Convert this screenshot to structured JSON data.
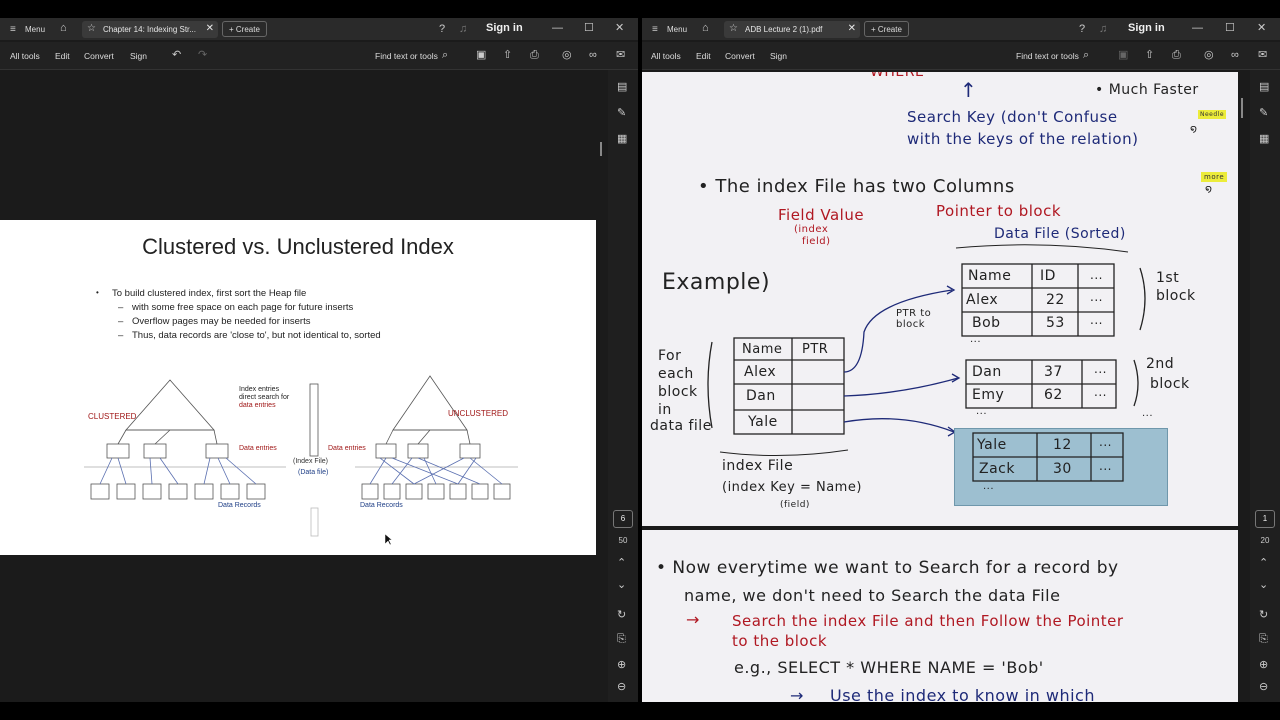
{
  "left": {
    "menu_label": "Menu",
    "tab_title": "Chapter 14: Indexing Str...",
    "create_label": "Create",
    "sign_in": "Sign in",
    "toolbar": {
      "all_tools": "All tools",
      "edit": "Edit",
      "convert": "Convert",
      "sign": "Sign",
      "find": "Find text or tools"
    },
    "page_number": "6",
    "page_total": "50",
    "slide": {
      "title": "Clustered vs. Unclustered Index",
      "bullet": "To build clustered index, first sort the Heap file",
      "sub_bullets": [
        "with some free space on each page for future inserts",
        "Overflow pages may be needed for inserts",
        "Thus, data records are 'close to', but not identical to, sorted"
      ],
      "diagram": {
        "clustered": "CLUSTERED",
        "unclustered": "UNCLUSTERED",
        "index_entries_line1": "Index entries",
        "index_entries_line2": "direct search for",
        "index_entries_line3": "data entries",
        "data_entries_left": "Data entries",
        "data_entries_right": "Data entries",
        "index_file": "(Index File)",
        "data_file": "(Data file)",
        "data_records_left": "Data Records",
        "data_records_right": "Data Records"
      }
    }
  },
  "right": {
    "menu_label": "Menu",
    "tab_title": "ADB Lecture 2 (1).pdf",
    "create_label": "Create",
    "sign_in": "Sign in",
    "toolbar": {
      "all_tools": "All tools",
      "edit": "Edit",
      "convert": "Convert",
      "sign": "Sign",
      "find": "Find text or tools"
    },
    "page_number": "1",
    "page_total": "20",
    "notes_page1": {
      "where_partial": "WHERE",
      "search_key_line1": "Search Key (don't Confuse",
      "search_key_line2": "with the keys of the relation)",
      "much_faster": "• Much Faster",
      "index_file_cols": "• The index File has two Columns",
      "field_value": "Field Value",
      "index_field_line1": "(index",
      "index_field_line2": "field)",
      "pointer_to_block": "Pointer to block",
      "data_file_sorted": "Data File (Sorted)",
      "example": "Example)",
      "ptr_to_block_line1": "PTR to",
      "ptr_to_block_line2": "block",
      "for_each_line1": "For",
      "for_each_line2": "each",
      "for_each_line3": "block",
      "for_each_line4": "in",
      "for_each_line5": "data file",
      "index_table_headers": [
        "Name",
        "PTR"
      ],
      "index_table_rows": [
        "Alex",
        "Dan",
        "Yale"
      ],
      "block1_header": [
        "Name",
        "ID",
        "..."
      ],
      "block1_rows": [
        [
          "Alex",
          "22",
          "..."
        ],
        [
          "Bob",
          "53",
          "..."
        ]
      ],
      "block1_label_line1": "1st",
      "block1_label_line2": "block",
      "block2_rows": [
        [
          "Dan",
          "37",
          "..."
        ],
        [
          "Emy",
          "62",
          "..."
        ]
      ],
      "block2_label_line1": "2nd",
      "block2_label_line2": "block",
      "block3_rows": [
        [
          "Yale",
          "12",
          "..."
        ],
        [
          "Zack",
          "30",
          "..."
        ]
      ],
      "ellipsis": "...",
      "index_file_label": "index File",
      "index_key_label": "(index Key = Name)",
      "field_label": "(field)",
      "sticky1": "Needle",
      "sticky2": "more"
    },
    "notes_page2": {
      "line1": "• Now everytime we want to Search for a record by",
      "line2": "name, we don't need to Search the data File",
      "line3": "Search the index File and then Follow the Pointer",
      "line4": "to the block",
      "line5": "e.g.,   SELECT * WHERE NAME = 'Bob'",
      "line6": "Use the index to know in which"
    }
  }
}
